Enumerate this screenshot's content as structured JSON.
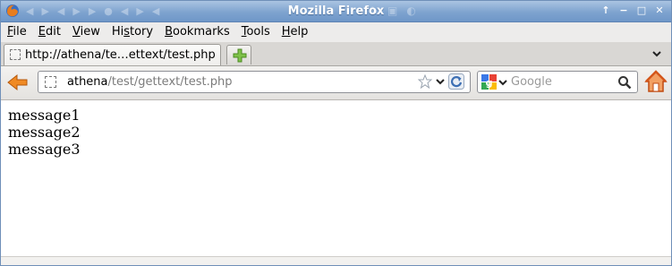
{
  "window": {
    "title": "Mozilla Firefox"
  },
  "menu": {
    "items": [
      {
        "accel": "F",
        "rest": "ile"
      },
      {
        "accel": "E",
        "rest": "dit"
      },
      {
        "accel": "V",
        "rest": "iew"
      },
      {
        "pre": "Hi",
        "accel": "s",
        "rest": "tory"
      },
      {
        "accel": "B",
        "rest": "ookmarks"
      },
      {
        "accel": "T",
        "rest": "ools"
      },
      {
        "accel": "H",
        "rest": "elp"
      }
    ]
  },
  "tab": {
    "label": "http://athena/te…ettext/test.php"
  },
  "urlbar": {
    "host": "athena",
    "path": "/test/gettext/test.php"
  },
  "search": {
    "placeholder": "Google",
    "value": ""
  },
  "content": {
    "lines": [
      "message1",
      "message2",
      "message3"
    ]
  },
  "colors": {
    "titlebar": "#7ea3cf",
    "back_arrow": "#e8791c",
    "home": "#e06020"
  },
  "icons": {
    "app": "firefox-icon",
    "back": "back-arrow-icon",
    "bookmark": "star-icon",
    "reload": "reload-icon",
    "search_engine": "google-icon",
    "search": "magnifier-icon",
    "home": "home-icon",
    "new_tab": "plus-icon"
  }
}
